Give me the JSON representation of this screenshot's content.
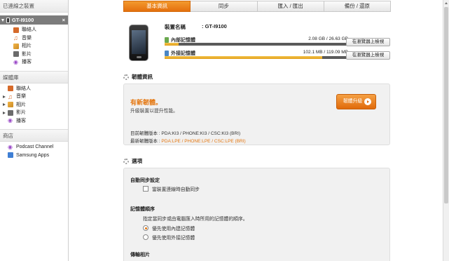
{
  "sidebar": {
    "connected_header": "已連線之裝置",
    "device": {
      "name": "GT-I9100",
      "close": "×"
    },
    "device_items": [
      {
        "label": "聯絡人",
        "icon": "contacts-icon"
      },
      {
        "label": "音樂",
        "icon": "music-icon"
      },
      {
        "label": "相片",
        "icon": "photo-icon"
      },
      {
        "label": "影片",
        "icon": "video-icon"
      },
      {
        "label": "播客",
        "icon": "podcast-icon"
      }
    ],
    "library_header": "媒體庫",
    "library_items": [
      {
        "label": "聯絡人",
        "icon": "contacts-icon"
      },
      {
        "label": "音樂",
        "icon": "music-icon"
      },
      {
        "label": "相片",
        "icon": "photo-icon"
      },
      {
        "label": "影片",
        "icon": "video-icon"
      },
      {
        "label": "播客",
        "icon": "podcast-icon"
      }
    ],
    "shop_header": "商店",
    "shop_items": [
      {
        "label": "Podcast Channel",
        "icon": "podcast-icon"
      },
      {
        "label": "Samsung Apps",
        "icon": "apps-icon"
      }
    ]
  },
  "tabs": [
    "基本資訊",
    "同步",
    "匯入 / 匯出",
    "備份 / 還原"
  ],
  "active_tab": 0,
  "device_info": {
    "name_label": "裝置名稱",
    "name_value": ":   GT-I9100",
    "internal": {
      "label": "內部記憶體",
      "size": "2.08 GB / 26.63 GB",
      "fraction": 0.078,
      "button": "在瀏覽器上檢視"
    },
    "external": {
      "label": "外接記憶體",
      "size": "102.1 MB / 119.09 MB",
      "fraction": 0.857,
      "button": "在瀏覽器上檢視"
    }
  },
  "firmware": {
    "title": "韌體資訊",
    "new_title": "有新韌體。",
    "desc": "升級裝置以提升性能。",
    "button": "韌體升級",
    "current": "目前韌體版本 : PDA:KI3 / PHONE:KI3 / CSC:KI3 (BRI)",
    "latest_label": "最新韌體版本 : ",
    "latest_value": "PDA:LPE / PHONE:LPE / CSC:LPE (BRI)"
  },
  "options": {
    "title": "選項",
    "auto_sync_heading": "自動同步設定",
    "auto_sync_checkbox": "當裝置連線時自動同步",
    "memory_order_heading": "記憶體順序",
    "memory_order_desc": "指定當同步或由電腦匯入時所用的記憶體的順序。",
    "radio_internal": "優先使用內建記憶體",
    "radio_external": "優先使用外接記憶體",
    "transfer_heading": "傳輸相片"
  },
  "colors": {
    "accent": "#e4760f",
    "tab_active": "#ef8a1f",
    "bar_fill": "#f0b63a"
  }
}
